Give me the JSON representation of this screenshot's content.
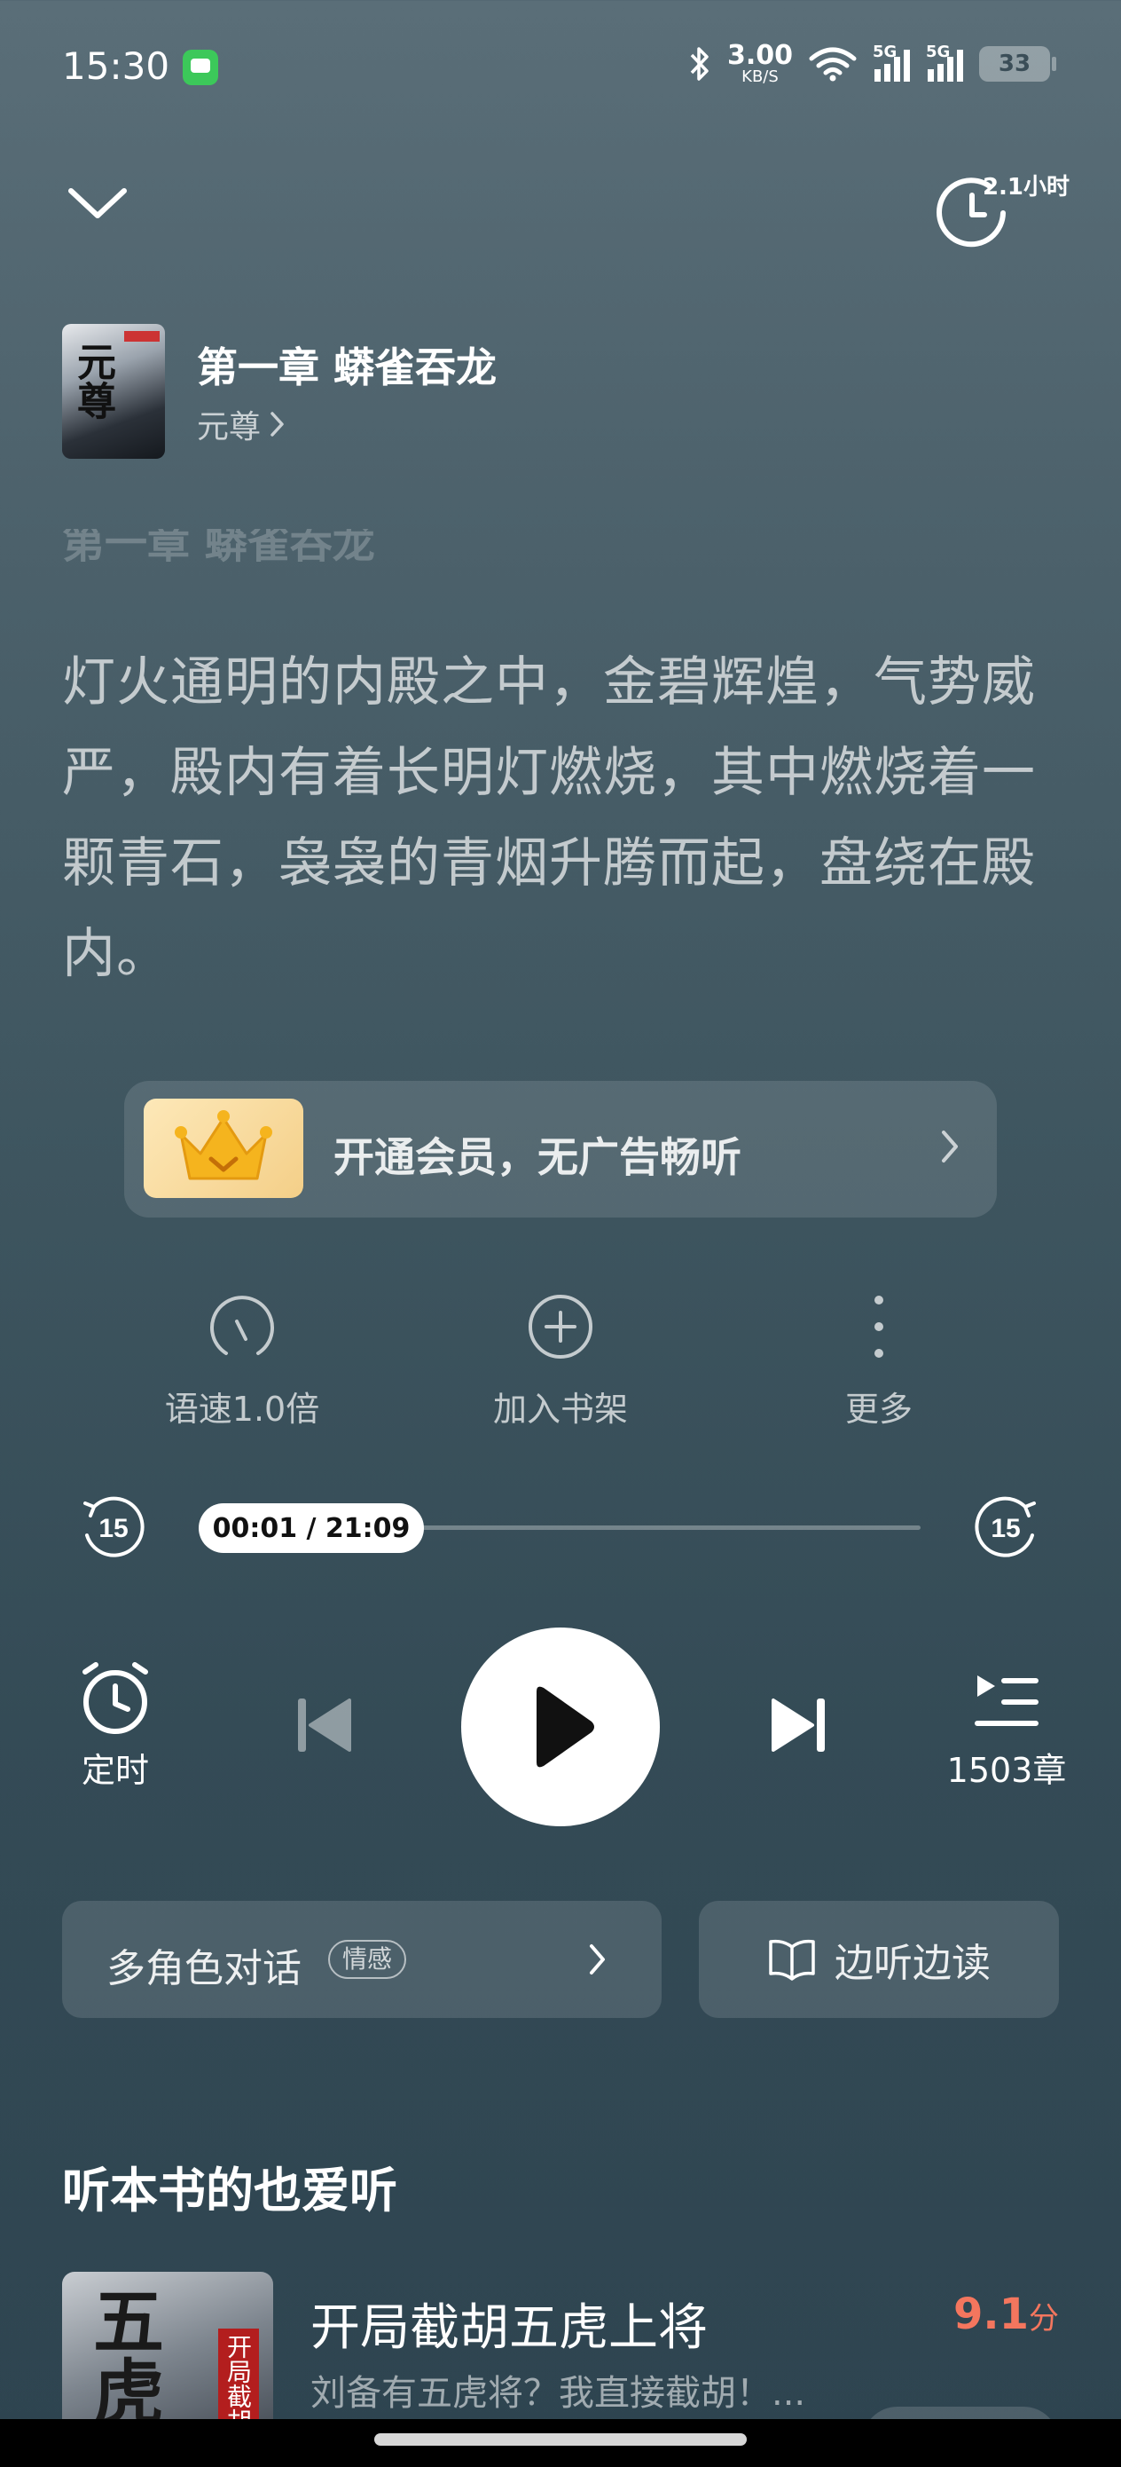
{
  "status_bar": {
    "time": "15:30",
    "net_speed_value": "3.00",
    "net_speed_unit": "KB/S",
    "signal1_tag": "5G",
    "signal2_tag": "5G",
    "battery": "33",
    "icons": [
      "message-app-icon",
      "bluetooth-icon",
      "wifi-icon",
      "signal-icon",
      "battery-icon"
    ]
  },
  "top_bar": {
    "timer_label": "2.1小时"
  },
  "book": {
    "chapter_title": "第一章 蟒雀吞龙",
    "book_name": "元尊",
    "cover_text": "元尊"
  },
  "content": {
    "faded_heading": "第一章 蟒雀吞龙",
    "paragraph": "灯火通明的内殿之中，金碧辉煌，气势威严，殿内有着长明灯燃烧，其中燃烧着一颗青石，袅袅的青烟升腾而起，盘绕在殿内。"
  },
  "vip_banner": {
    "text": "开通会员，无广告畅听"
  },
  "actions": {
    "speed": "语速1.0倍",
    "add_shelf": "加入书架",
    "more": "更多"
  },
  "progress": {
    "time_display": "00:01 / 21:09",
    "current": "00:01",
    "total": "21:09",
    "fraction": 0.0008,
    "rewind_seconds": "15",
    "forward_seconds": "15"
  },
  "controls": {
    "timer_label": "定时",
    "chapters_label": "1503章",
    "state": "paused"
  },
  "bottom_buttons": {
    "multi_role": "多角色对话",
    "multi_role_tag": "情感",
    "listen_read": "边听边读"
  },
  "recommend": {
    "heading": "听本书的也爱听",
    "items": [
      {
        "title": "开局截胡五虎上将",
        "score": "9.1",
        "score_unit": "分",
        "desc": "刘备有五虎将？我直接截胡！...",
        "cover_text": "五虎上",
        "cover_sub": "开局截胡"
      }
    ]
  },
  "colors": {
    "accent_score": "#f4765e",
    "crown_bg": "#f4cf88"
  }
}
